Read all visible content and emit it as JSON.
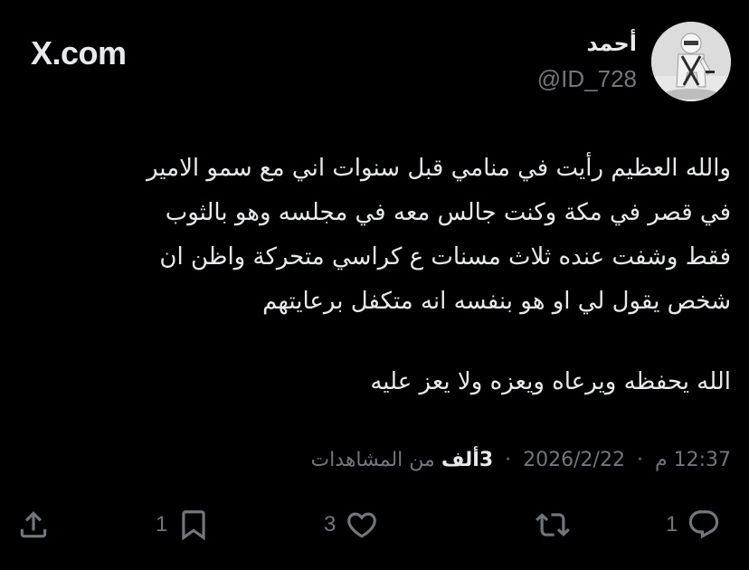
{
  "header": {
    "brand": "X.com",
    "display_name": "أحمد",
    "handle": "@ID_728"
  },
  "tweet": {
    "lines": [
      "والله العظيم رأيت في منامي قبل سنوات اني مع سمو الامير",
      "في قصر في مكة وكنت جالس معه في مجلسه وهو بالثوب",
      "فقط وشفت عنده ثلاث مسنات ع كراسي متحركة واظن ان",
      "شخص يقول لي او هو بنفسه انه متكفل برعايتهم"
    ],
    "closing": "الله يحفظه ويرعاه ويعزه ولا يعز عليه"
  },
  "meta": {
    "time": "12:37",
    "ampm": "م",
    "date": "2026/2/22",
    "views_count": "3ألف",
    "views_label": "من المشاهدات"
  },
  "actions": {
    "replies": "1",
    "reposts": "",
    "likes": "3",
    "bookmarks": "1"
  },
  "icons": [
    "reply-icon",
    "repost-icon",
    "like-icon",
    "bookmark-icon",
    "share-icon"
  ],
  "colors": {
    "background": "#000000",
    "text": "#e7e9ea",
    "secondary": "#71767b"
  }
}
